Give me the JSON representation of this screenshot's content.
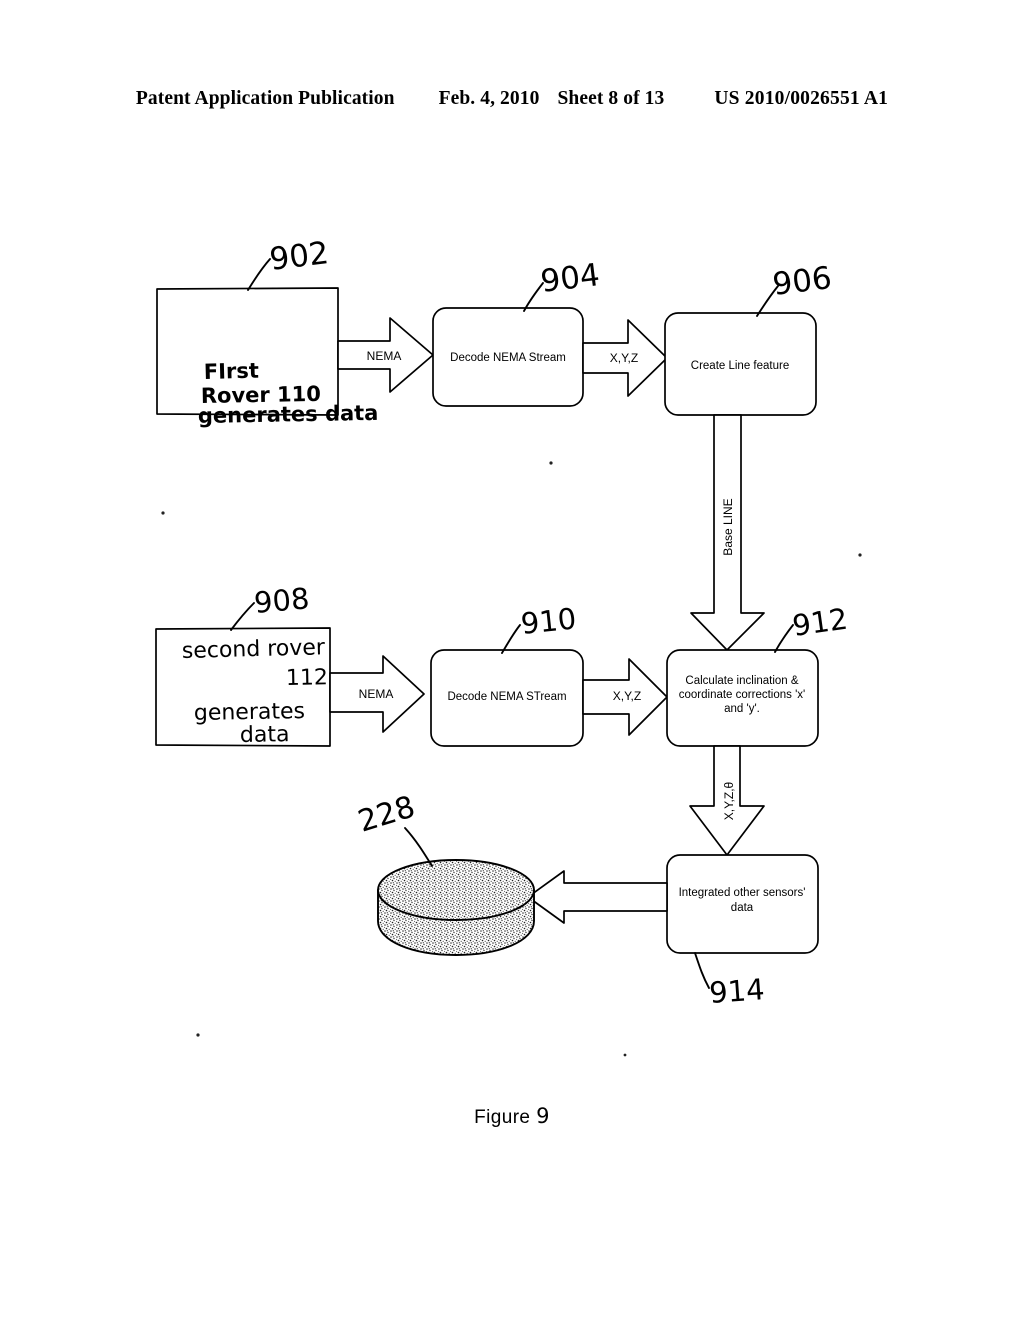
{
  "header": {
    "publication": "Patent Application Publication",
    "date": "Feb. 4, 2010",
    "sheet": "Sheet 8 of 13",
    "number": "US 2010/0026551 A1"
  },
  "figure": {
    "caption_prefix": "Figure",
    "caption_number": "9"
  },
  "diagram": {
    "type": "flowchart",
    "nodes": [
      {
        "id": "n902",
        "ref": "902",
        "shape": "rectangle",
        "style": "handwritten",
        "text_lines": [
          "FIrst",
          "Rover 110",
          "generates data"
        ]
      },
      {
        "id": "n904",
        "ref": "904",
        "shape": "rounded-rectangle",
        "style": "printed",
        "text_lines": [
          "Decode NEMA Stream"
        ]
      },
      {
        "id": "n906",
        "ref": "906",
        "shape": "rounded-rectangle",
        "style": "printed",
        "text_lines": [
          "Create Line feature"
        ]
      },
      {
        "id": "n908",
        "ref": "908",
        "shape": "rectangle",
        "style": "handwritten",
        "text_lines": [
          "second rover",
          "112",
          "generates",
          "data"
        ]
      },
      {
        "id": "n910",
        "ref": "910",
        "shape": "rounded-rectangle",
        "style": "printed",
        "text_lines": [
          "Decode NEMA STream"
        ]
      },
      {
        "id": "n912",
        "ref": "912",
        "shape": "rounded-rectangle",
        "style": "printed",
        "text_lines": [
          "Calculate inclination &",
          "coordinate corrections 'x'",
          "and 'y'."
        ]
      },
      {
        "id": "n914",
        "ref": "914",
        "shape": "rounded-rectangle",
        "style": "printed",
        "text_lines": [
          "Integrated other sensors'",
          "data"
        ]
      },
      {
        "id": "n228",
        "ref": "228",
        "shape": "cylinder-database",
        "style": "stippled",
        "text_lines": []
      }
    ],
    "edges": [
      {
        "id": "e1",
        "from": "n902",
        "to": "n904",
        "label": "NEMA",
        "direction": "right"
      },
      {
        "id": "e2",
        "from": "n904",
        "to": "n906",
        "label": "X,Y,Z",
        "direction": "right"
      },
      {
        "id": "e3",
        "from": "n906",
        "to": "n912",
        "label": "Base LINE",
        "direction": "down"
      },
      {
        "id": "e4",
        "from": "n908",
        "to": "n910",
        "label": "NEMA",
        "direction": "right"
      },
      {
        "id": "e5",
        "from": "n910",
        "to": "n912",
        "label": "X,Y,Z",
        "direction": "right"
      },
      {
        "id": "e6",
        "from": "n912",
        "to": "n914",
        "label": "X,Y,Z,θ",
        "direction": "down"
      },
      {
        "id": "e7",
        "from": "n914",
        "to": "n228",
        "label": "",
        "direction": "left"
      }
    ]
  },
  "labels": {
    "nema": "NEMA",
    "xyz": "X,Y,Z",
    "baseline": "Base LINE",
    "xyztheta": "X,Y,Z,θ",
    "ref902": "902",
    "ref904": "904",
    "ref906": "906",
    "ref908": "908",
    "ref910": "910",
    "ref912": "912",
    "ref914": "914",
    "ref228": "228",
    "box902_l1": "FIrst",
    "box902_l2": "Rover 110",
    "box902_l3": "generates data",
    "box904_l1": "Decode NEMA Stream",
    "box906_l1": "Create Line feature",
    "box908_l1": "second rover",
    "box908_l2": "112",
    "box908_l3": "generates",
    "box908_l4": "data",
    "box910_l1": "Decode NEMA STream",
    "box912_l1": "Calculate inclination &",
    "box912_l2": "coordinate corrections 'x'",
    "box912_l3": "and 'y'.",
    "box914_l1": "Integrated other sensors'",
    "box914_l2": "data"
  },
  "colors": {
    "ink": "#000000",
    "paper": "#ffffff"
  }
}
